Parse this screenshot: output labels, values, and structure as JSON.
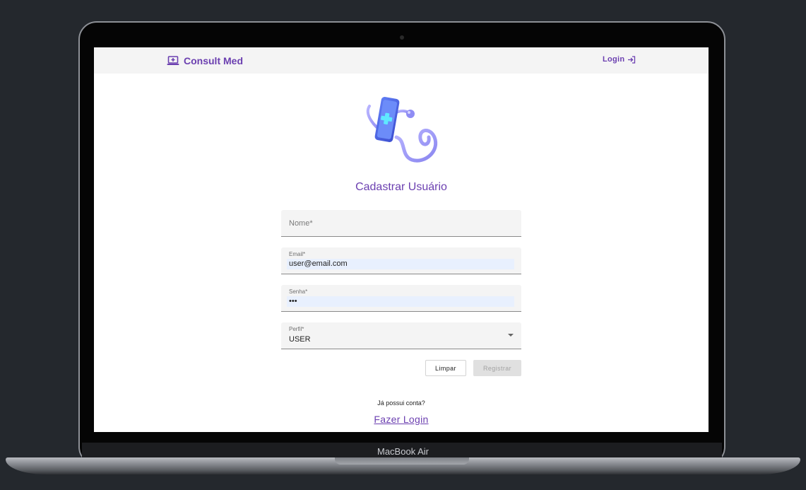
{
  "device": {
    "label": "MacBook Air"
  },
  "navbar": {
    "brand": "Consult Med",
    "brand_icon": "laptop-medical-icon",
    "login_label": "Login",
    "login_icon": "login-arrow-icon"
  },
  "hero": {
    "image_icon": "phone-stethoscope-icon"
  },
  "form": {
    "title": "Cadastrar Usuário",
    "name_field": {
      "placeholder": "Nome*",
      "value": ""
    },
    "email_field": {
      "label": "Email*",
      "value": "user@email.com"
    },
    "password_field": {
      "label": "Senha*",
      "value": "•••"
    },
    "profile_field": {
      "label": "Perfil*",
      "value": "USER"
    },
    "clear_label": "Limpar",
    "register_label": "Registrar"
  },
  "footer": {
    "question": "Já possui conta?",
    "login_cta": "Fazer Login"
  },
  "colors": {
    "accent": "#6b3fb0",
    "page_bg": "#24282d",
    "navbar_bg": "#f4f4f4",
    "autofill_bg": "#e8f0fe"
  }
}
